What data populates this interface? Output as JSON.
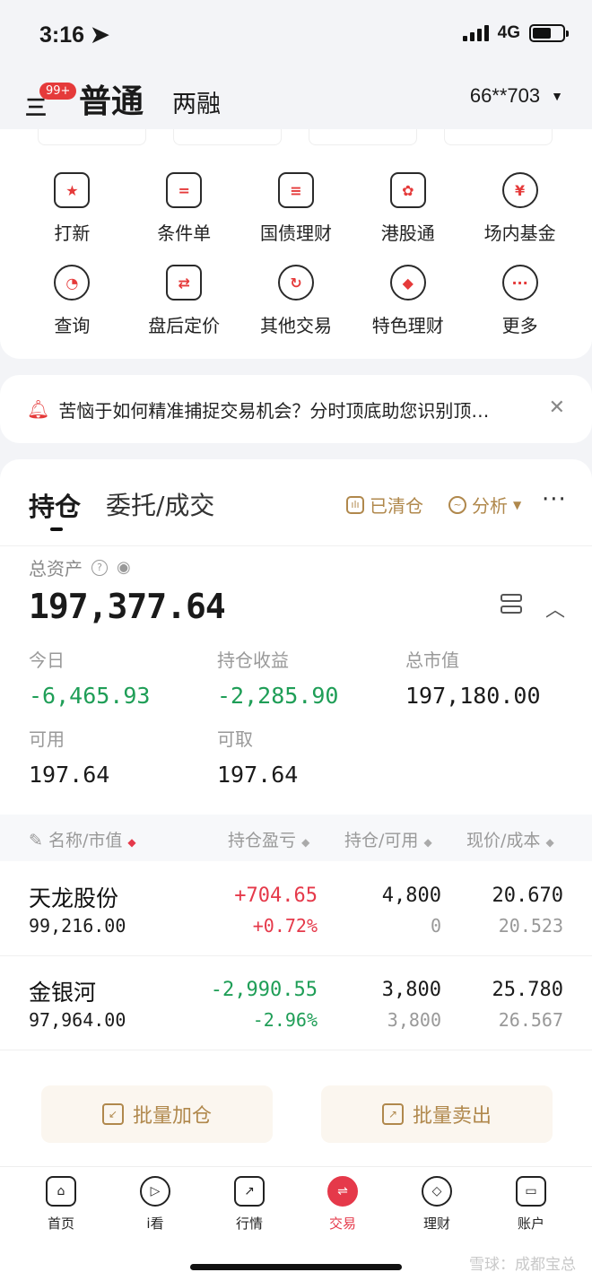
{
  "status": {
    "time": "3:16",
    "network": "4G"
  },
  "topnav": {
    "badge": "99+",
    "tab_normal": "普通",
    "tab_margin": "两融",
    "account": "66**703"
  },
  "quick_grid": [
    {
      "label": "打新",
      "icon": "star-icon"
    },
    {
      "label": "条件单",
      "icon": "document-icon"
    },
    {
      "label": "国债理财",
      "icon": "ticket-icon"
    },
    {
      "label": "港股通",
      "icon": "hk-flower-icon"
    },
    {
      "label": "场内基金",
      "icon": "yen-icon"
    },
    {
      "label": "查询",
      "icon": "search-icon"
    },
    {
      "label": "盘后定价",
      "icon": "exchange-icon"
    },
    {
      "label": "其他交易",
      "icon": "refresh-icon"
    },
    {
      "label": "特色理财",
      "icon": "medal-icon"
    },
    {
      "label": "更多",
      "icon": "more-icon"
    }
  ],
  "notice": {
    "text": "苦恼于如何精准捕捉交易机会？分时顶底助您识别顶…"
  },
  "holdings": {
    "tab_positions": "持仓",
    "tab_orders": "委托/成交",
    "cleared": "已清仓",
    "analysis": "分析",
    "total_label": "总资产",
    "total_value": "197,377.64",
    "today_label": "今日",
    "today_value": "-6,465.93",
    "pos_profit_label": "持仓收益",
    "pos_profit_value": "-2,285.90",
    "market_value_label": "总市值",
    "market_value_value": "197,180.00",
    "available_label": "可用",
    "available_value": "197.64",
    "withdrawable_label": "可取",
    "withdrawable_value": "197.64"
  },
  "table": {
    "headers": [
      "名称/市值",
      "持仓盈亏",
      "持仓/可用",
      "现价/成本"
    ],
    "rows": [
      {
        "name": "天龙股份",
        "market_value": "99,216.00",
        "pnl": "+704.65",
        "pnl_pct": "+0.72%",
        "position": "4,800",
        "available": "0",
        "price": "20.670",
        "cost": "20.523"
      },
      {
        "name": "金银河",
        "market_value": "97,964.00",
        "pnl": "-2,990.55",
        "pnl_pct": "-2.96%",
        "position": "3,800",
        "available": "3,800",
        "price": "25.780",
        "cost": "26.567"
      }
    ]
  },
  "buttons": {
    "batch_add": "批量加仓",
    "batch_sell": "批量卖出"
  },
  "bottom_nav": [
    "首页",
    "i看",
    "行情",
    "交易",
    "理财",
    "账户"
  ],
  "watermark": "雪球：成都宝总",
  "colors": {
    "up": "#e5394a",
    "down": "#1f9e57",
    "accent_gold": "#b0884c"
  }
}
